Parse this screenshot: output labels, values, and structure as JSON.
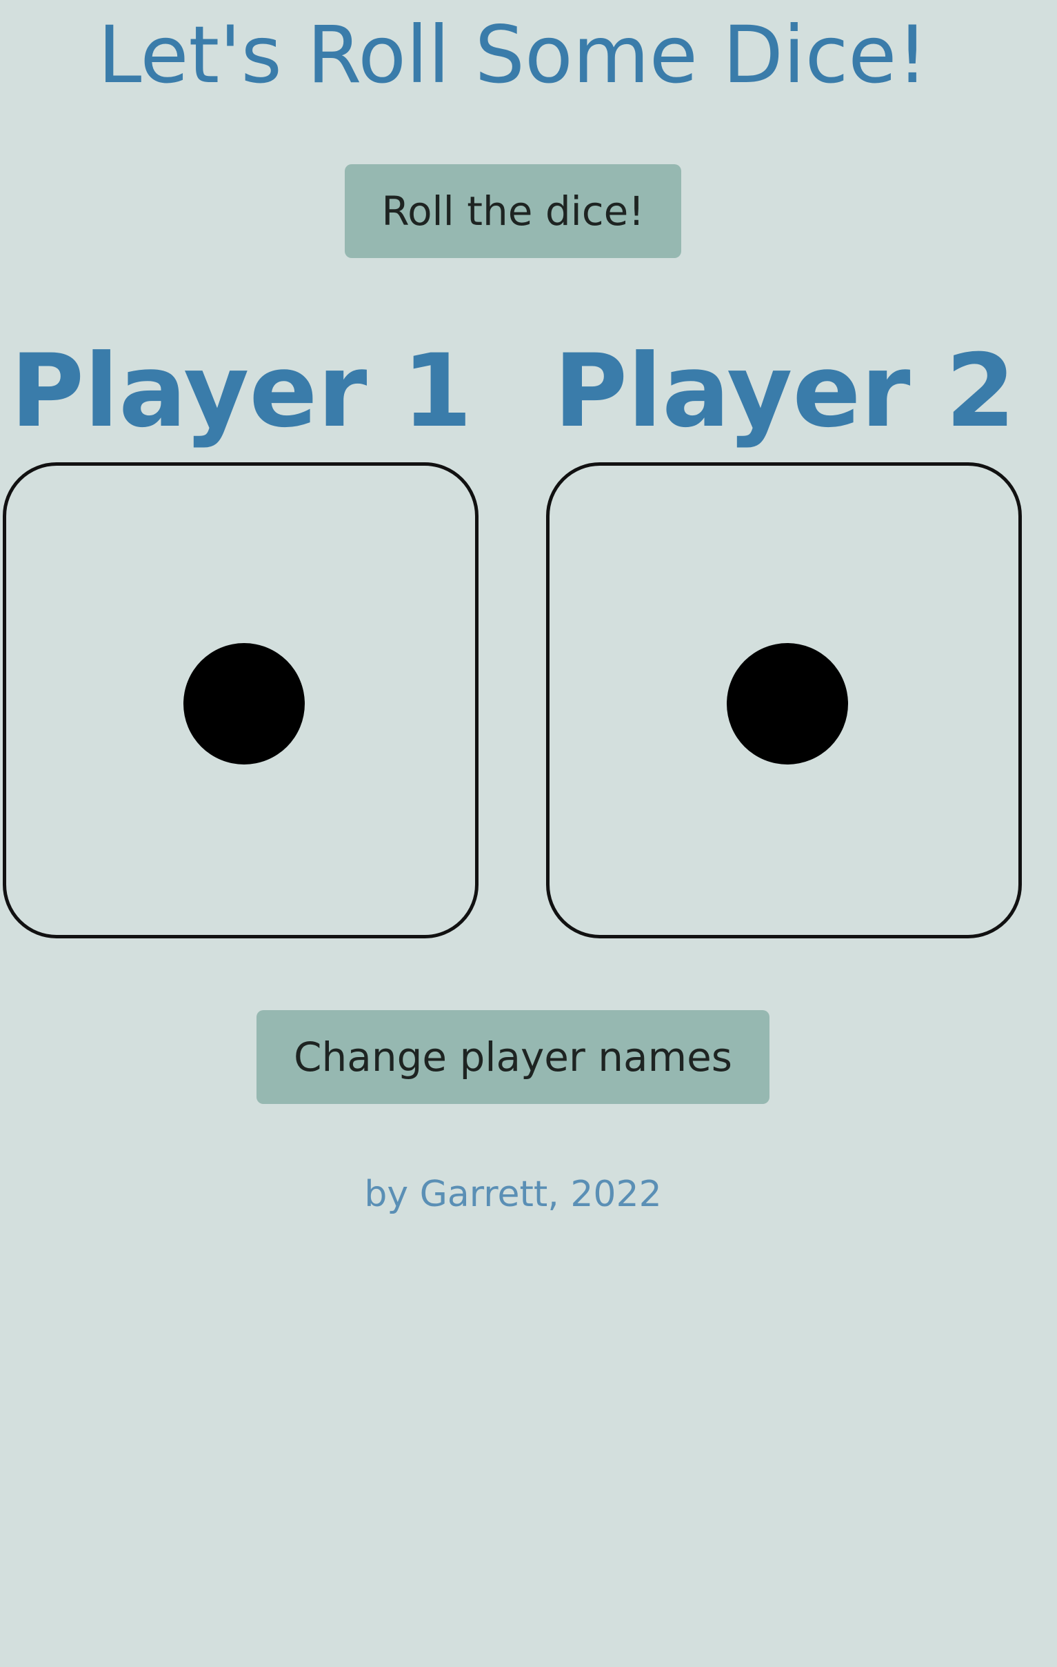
{
  "header": {
    "title": "Let's Roll Some Dice!"
  },
  "controls": {
    "roll_label": "Roll the dice!",
    "change_names_label": "Change player names"
  },
  "players": [
    {
      "name": "Player 1",
      "die_value": 1
    },
    {
      "name": "Player 2",
      "die_value": 1
    }
  ],
  "footer": {
    "credit": "by Garrett, 2022"
  },
  "colors": {
    "background": "#d3dfdd",
    "accent": "#3a7caa",
    "button": "#96b8b1",
    "pip": "#000000"
  }
}
